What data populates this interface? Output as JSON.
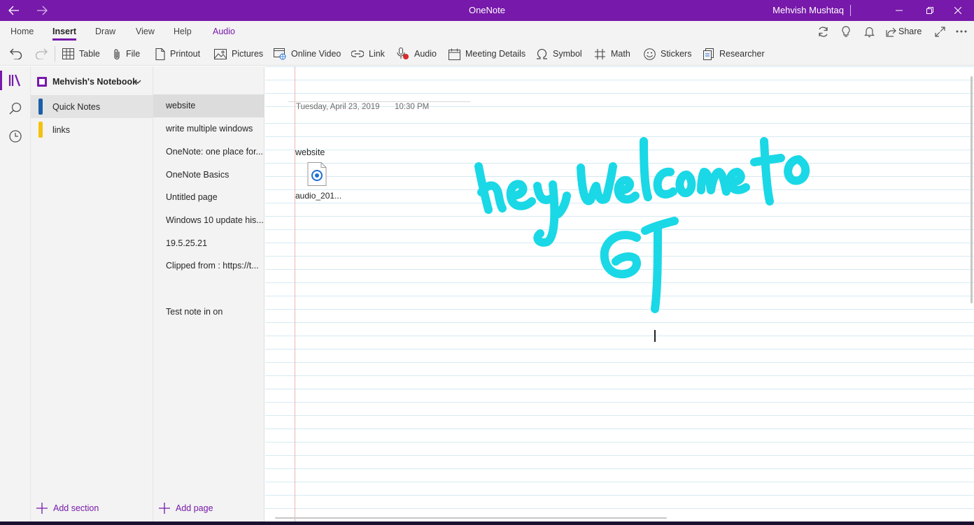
{
  "window": {
    "app_title": "OneNote",
    "user_name": "Mehvish Mushtaq",
    "accent_color": "#7719aa"
  },
  "menu": {
    "tabs": [
      {
        "label": "Home"
      },
      {
        "label": "Insert"
      },
      {
        "label": "Draw"
      },
      {
        "label": "View"
      },
      {
        "label": "Help"
      },
      {
        "label": "Audio"
      }
    ],
    "share_label": "Share"
  },
  "ribbon": {
    "items": [
      {
        "label": "Table",
        "icon": "table-icon"
      },
      {
        "label": "File",
        "icon": "paperclip-icon"
      },
      {
        "label": "Printout",
        "icon": "document-icon"
      },
      {
        "label": "Pictures",
        "icon": "picture-icon"
      },
      {
        "label": "Online Video",
        "icon": "online-video-icon"
      },
      {
        "label": "Link",
        "icon": "link-icon"
      },
      {
        "label": "Audio",
        "icon": "audio-record-icon"
      },
      {
        "label": "Meeting Details",
        "icon": "calendar-icon"
      },
      {
        "label": "Symbol",
        "icon": "omega-icon"
      },
      {
        "label": "Math",
        "icon": "math-icon"
      },
      {
        "label": "Stickers",
        "icon": "smiley-icon"
      },
      {
        "label": "Researcher",
        "icon": "researcher-icon"
      }
    ]
  },
  "notebook": {
    "name": "Mehvish's Notebook",
    "sections": [
      {
        "label": "Quick Notes",
        "color": "#1b5fa8"
      },
      {
        "label": "links",
        "color": "#f4c20d"
      }
    ],
    "add_section_label": "Add section"
  },
  "pages": {
    "items": [
      {
        "label": "website"
      },
      {
        "label": "write multiple windows"
      },
      {
        "label": "OneNote: one place for..."
      },
      {
        "label": "OneNote Basics"
      },
      {
        "label": "Untitled page"
      },
      {
        "label": "Windows 10 update his..."
      },
      {
        "label": "19.5.25.21"
      },
      {
        "label": "Clipped from : https://t..."
      },
      {
        "label": ""
      },
      {
        "label": "Test note in on"
      }
    ],
    "add_page_label": "Add page"
  },
  "page_content": {
    "date": "Tuesday, April 23, 2019",
    "time": "10:30 PM",
    "note_text": "website",
    "attachment_name": "audio_201...",
    "ink_color": "#1ad8e6"
  }
}
